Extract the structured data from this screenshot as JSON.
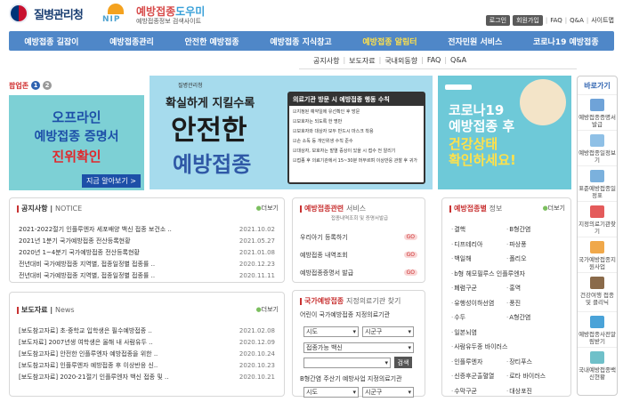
{
  "header": {
    "agency": "질병관리청",
    "site_name_a": "예방접종",
    "site_name_b": "도우미",
    "site_sub": "예방접종정보 검색사이트",
    "nip": "NIP",
    "top_links": [
      "로그인",
      "회원가입",
      "FAQ",
      "Q&A",
      "사이트맵"
    ]
  },
  "gnb": {
    "items": [
      "예방접종 길잡이",
      "예방접종관리",
      "안전한 예방접종",
      "예방접종 지식창고",
      "예방접종 알림터",
      "전자민원 서비스",
      "코로나19 예방접종"
    ],
    "active_index": 4
  },
  "subnav": {
    "items": [
      "공지사항",
      "보도자료",
      "국내외동향",
      "FAQ",
      "Q&A"
    ]
  },
  "popup": {
    "label": "팝업존",
    "pages": [
      "1",
      "2"
    ],
    "line1": "오프라인",
    "line2": "예방접종 증명서",
    "line3": "진위확인",
    "more": "지금 알아보기 >"
  },
  "banner_main": {
    "headline_small": "확실하게 지킬수록",
    "headline_big": "안전한",
    "headline_blue": "예방접종",
    "card_title": "의료기관 방문 시 예방접종 행동 수칙",
    "rules": [
      "지정된 예약일에 유선확인 후 방문",
      "보호자는 되도록 한 명만",
      "보호자와 대상자 모두 반드시 마스크 착용",
      "손 소독 등 개인위생 수칙 준수",
      "대상자, 보호자는 발열 증상이 있을 시 접수 전 알리기",
      "접종 후 의료기관에서 15~30분 머무르며 이상반응 관찰 후 귀가"
    ]
  },
  "banner_covid": {
    "line1": "코로나19",
    "line2": "예방접종 후",
    "line3": "건강상태",
    "line4": "확인하세요!"
  },
  "quick_menu": {
    "title": "바로가기",
    "items": [
      "예방접종증명서 발급",
      "예방접종일정보기",
      "표준예방접종일정표",
      "지정의료기관찾기",
      "국가예방접종지원사업",
      "건강여행 접종 및 클리닉",
      "예방접종사전알림받기",
      "국내예방접종백신현황"
    ]
  },
  "notice": {
    "title": "공지사항",
    "title_en": "NOTICE",
    "more": "더보기",
    "rows": [
      {
        "title": "2021-2022절기 인플루엔자 세포배양 백신 접종 보건소 ..",
        "date": "2021.10.02"
      },
      {
        "title": "2021년 1분기 국가예방접종 전산등록현황",
        "date": "2021.05.27"
      },
      {
        "title": "2020년 1~4분기 국가예방접종 전산등록현황",
        "date": "2021.01.08"
      },
      {
        "title": "전년대비 국가예방접종 지역별, 접종일정별 접종률 ..",
        "date": "2020.12.23"
      },
      {
        "title": "전년대비 국가예방접종 지역별, 접종일정별 접종률 ..",
        "date": "2020.11.11"
      }
    ]
  },
  "materials": {
    "title": "보도자료",
    "title_en": "News",
    "more": "더보기",
    "rows": [
      {
        "title": "[보도참고자료] 초·중학교 입학생은 필수예방접종 ..",
        "date": "2021.02.08"
      },
      {
        "title": "[보도자료] 2007년생 여학생은 올해 내 사람유두 ..",
        "date": "2020.12.09"
      },
      {
        "title": "[보도참고자료] 안전한 인플루엔자 예방접종을 위한 ..",
        "date": "2020.10.24"
      },
      {
        "title": "[보도참고자료] 인플루엔자 예방접종 후 이상반응 신..",
        "date": "2020.10.23"
      },
      {
        "title": "[보도참고자료] 2020-21절기 인플루엔자 백신 접종 및 ..",
        "date": "2020.10.21"
      }
    ]
  },
  "service": {
    "title_a": "예방접종관련",
    "title_b": "서비스",
    "desc": "접종내역조회 및 증명서발급",
    "rows": [
      "우리아기 등록하기",
      "예방접종 내역조회",
      "예방접종증명서 발급"
    ],
    "go": "GO"
  },
  "hospital": {
    "title_a": "국가예방접종",
    "title_b": "지정의료기관 찾기",
    "q1": "어린이 국가예방접종 지정의료기관",
    "q2": "B형간염 주산기 예방사업 지정의료기관",
    "sido": "시도",
    "sigungu": "시군구",
    "vaccine_select": "접종가능 백신",
    "search": "검색"
  },
  "vaccine": {
    "title_a": "예방접종별",
    "title_b": "정보",
    "more": "더보기",
    "items": [
      "결핵",
      "B형간염",
      "디프테리아",
      "파상풍",
      "백일해",
      "폴리오",
      "b형 헤모필루스 인플루엔자",
      "",
      "폐렴구균",
      "홍역",
      "유행성이하선염",
      "풍진",
      "수두",
      "A형간염",
      "일본뇌염",
      "",
      "사람유두종 바이러스",
      "",
      "인플루엔자",
      "장티푸스",
      "신증후군출혈열",
      "로타 바이러스",
      "수막구균",
      "대상포진"
    ]
  },
  "colors": {
    "gnb": "#4f87c8",
    "gnb_active": "#ffe14a",
    "popup_bg": "#7dd0d5",
    "banner_bg": "#a6dbed",
    "covid_bg": "#6ec9d8"
  }
}
